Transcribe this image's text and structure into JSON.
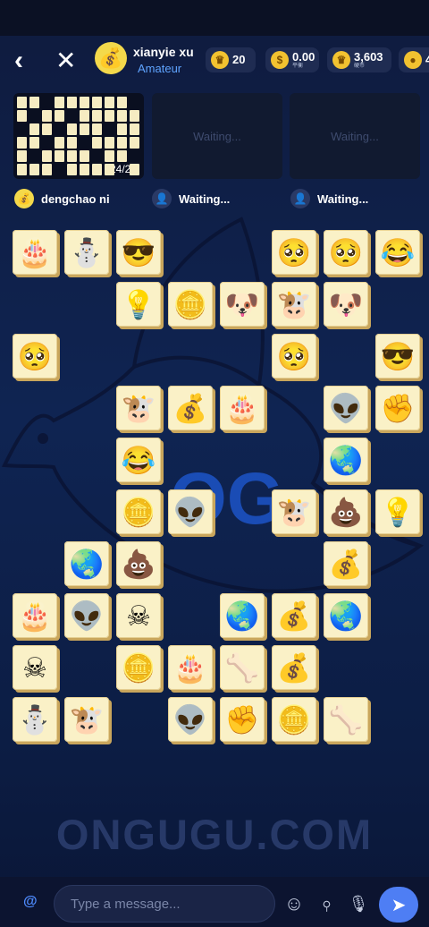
{
  "header": {
    "back_glyph": "‹",
    "close_glyph": "✕",
    "avatar_glyph": "💰",
    "username": "xianyie xu",
    "rank": "Amateur",
    "stats": [
      {
        "icon": "crown-coin-icon",
        "glyph": "♛",
        "value": "20",
        "sub": ""
      },
      {
        "icon": "money-bag-icon",
        "glyph": "$",
        "value": "0.00",
        "sub": "平衡"
      },
      {
        "icon": "crown-coin-icon",
        "glyph": "♛",
        "value": "3,603",
        "sub": "硬币"
      },
      {
        "icon": "gold-coin-icon",
        "glyph": "●",
        "value": "4",
        "sub": ""
      }
    ]
  },
  "players": {
    "mini_progress": "24/25",
    "waiting_slot_1": "Waiting...",
    "waiting_slot_2": "Waiting...",
    "player1_name": "dengchao ni",
    "player2_name": "Waiting...",
    "player3_name": "Waiting...",
    "player1_avatar_glyph": "💰",
    "waiting_avatar_glyph": "👤"
  },
  "board": {
    "tile_faces": {
      "cake": "🎂",
      "snowman": "⛄",
      "sunglasses": "😎",
      "pleading": "🥺",
      "grin": "😂",
      "bulb": "💡",
      "coin": "🪙",
      "dog": "🐶",
      "cow": "🐮",
      "moneybag": "💰",
      "alien": "👽",
      "fist": "✊",
      "globe": "🌏",
      "poop": "💩",
      "skull": "☠",
      "bone": "🦴"
    },
    "rows": [
      [
        "cake",
        "snowman",
        "sunglasses",
        "",
        "",
        "pleading",
        "pleading",
        "grin"
      ],
      [
        "",
        "",
        "bulb",
        "coin",
        "dog",
        "cow",
        "dog",
        ""
      ],
      [
        "pleading",
        "",
        "",
        "",
        "",
        "pleading",
        "",
        "sunglasses"
      ],
      [
        "",
        "",
        "cow",
        "moneybag",
        "cake",
        "",
        "alien",
        "fist"
      ],
      [
        "",
        "",
        "grin",
        "",
        "",
        "",
        "globe",
        ""
      ],
      [
        "",
        "",
        "coin",
        "alien",
        "",
        "cow",
        "poop",
        "bulb"
      ],
      [
        "",
        "globe",
        "poop",
        "",
        "",
        "",
        "moneybag",
        ""
      ],
      [
        "cake",
        "alien",
        "skull",
        "",
        "globe",
        "moneybag",
        "globe",
        ""
      ],
      [
        "skull",
        "",
        "coin",
        "cake",
        "bone",
        "moneybag",
        "",
        ""
      ],
      [
        "snowman",
        "cow",
        "",
        "alien",
        "fist",
        "coin",
        "bone",
        ""
      ]
    ]
  },
  "watermark": {
    "logo_letters": "OG",
    "site": "ONGUGU.COM"
  },
  "chat": {
    "at_glyph": "@",
    "placeholder": "Type a message...",
    "emoji_glyph": "☺",
    "attach_glyph": "⌕",
    "mic_glyph": "🎙",
    "send_glyph": "➤"
  }
}
